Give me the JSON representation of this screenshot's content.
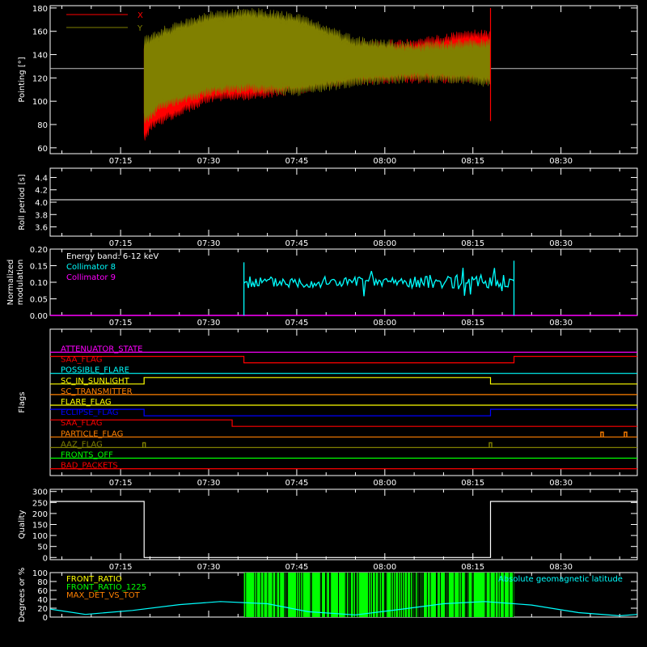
{
  "chart_data": [
    {
      "type": "line",
      "panel": "pointing",
      "ylabel": "Pointing [°]",
      "ylim": [
        55,
        182
      ],
      "yticks": [
        60,
        80,
        100,
        120,
        140,
        160,
        180
      ],
      "xlim": [
        "07:03",
        "08:43"
      ],
      "xticks": [
        "07:15",
        "07:30",
        "07:45",
        "08:00",
        "08:15",
        "08:30"
      ],
      "grid": false,
      "legend_position": "top-left",
      "colors": {
        "X": "#ff0000",
        "Y": "#808000",
        "reference": "#c0c0c0"
      },
      "series": [
        {
          "name": "X",
          "band": {
            "t": [
              "07:19",
              "07:20",
              "07:24",
              "07:30",
              "07:40",
              "07:48",
              "07:55",
              "08:05",
              "08:15",
              "08:18"
            ],
            "max": [
              150,
              138,
              155,
              168,
              165,
              150,
              146,
              148,
              156,
              155
            ],
            "min": [
              67,
              80,
              90,
              104,
              108,
              114,
              119,
              121,
              121,
              120
            ]
          }
        },
        {
          "name": "Y",
          "band": {
            "t": [
              "07:19",
              "07:22",
              "07:30",
              "07:37",
              "07:45",
              "07:50",
              "07:55",
              "08:05",
              "08:15",
              "08:18"
            ],
            "max": [
              150,
              158,
              172,
              175,
              170,
              160,
              150,
              145,
              148,
              148
            ],
            "min": [
              85,
              98,
              110,
              113,
              110,
              114,
              118,
              122,
              120,
              117
            ]
          }
        }
      ],
      "reference_line": 128,
      "spike_time": "08:18",
      "spike_range": [
        83,
        180
      ]
    },
    {
      "type": "line",
      "panel": "roll",
      "ylabel": "Roll period [s]",
      "ylim": [
        3.45,
        4.55
      ],
      "yticks": [
        3.6,
        3.8,
        4.0,
        4.2,
        4.4
      ],
      "xticks": [
        "07:15",
        "07:30",
        "07:45",
        "08:00",
        "08:15",
        "08:30"
      ],
      "series": [
        {
          "t": [
            "07:03",
            "08:43"
          ],
          "values": [
            4.04,
            4.04
          ]
        }
      ]
    },
    {
      "type": "line",
      "panel": "modulation",
      "ylabel": [
        "Normalized",
        "modulation"
      ],
      "ylim": [
        0.0,
        0.2
      ],
      "yticks": [
        0.0,
        0.05,
        0.1,
        0.15,
        0.2
      ],
      "xticks": [
        "07:15",
        "07:30",
        "07:45",
        "08:00",
        "08:15",
        "08:30"
      ],
      "legend_title": "Energy band: 6-12 keV",
      "series": [
        {
          "name": "Collimator 8",
          "color": "#00ffff",
          "active_range": [
            "07:36",
            "08:22"
          ],
          "baseline": 0.1,
          "jitter": 0.018
        },
        {
          "name": "Collimator 9",
          "color": "#ff00ff",
          "values": 0.0
        }
      ]
    },
    {
      "type": "line",
      "panel": "flags",
      "ylabel": "Flags",
      "xticks": [
        "07:15",
        "07:30",
        "07:45",
        "08:00",
        "08:15",
        "08:30"
      ],
      "series": [
        {
          "name": "ATTENUATOR_STATE",
          "color": "#ff00ff",
          "segments": [
            [
              "07:03",
              0
            ],
            [
              "08:43",
              0
            ]
          ]
        },
        {
          "name": "SAA_FLAG",
          "color": "#ff0000",
          "segments": [
            [
              "07:03",
              1
            ],
            [
              "07:36",
              0
            ],
            [
              "08:22",
              1
            ],
            [
              "08:43",
              1
            ]
          ]
        },
        {
          "name": "POSSIBLE_FLARE",
          "color": "#00ffff",
          "segments": [
            [
              "07:03",
              0
            ],
            [
              "08:43",
              0
            ]
          ]
        },
        {
          "name": "SC_IN_SUNLIGHT",
          "color": "#ffff00",
          "segments": [
            [
              "07:03",
              0
            ],
            [
              "07:19",
              1
            ],
            [
              "08:18",
              0
            ],
            [
              "08:43",
              0
            ]
          ]
        },
        {
          "name": "SC_TRANSMITTER",
          "color": "#ff8000",
          "segments": [
            [
              "07:03",
              0
            ],
            [
              "08:43",
              0
            ]
          ]
        },
        {
          "name": "FLARE_FLAG",
          "color": "#ffff00",
          "segments": [
            [
              "07:03",
              0
            ],
            [
              "08:43",
              0
            ]
          ]
        },
        {
          "name": "ECLIPSE_FLAG",
          "color": "#0000ff",
          "segments": [
            [
              "07:03",
              1
            ],
            [
              "07:19",
              0
            ],
            [
              "08:18",
              1
            ],
            [
              "08:43",
              1
            ]
          ]
        },
        {
          "name": "SAA_FLAG",
          "color": "#ff0000",
          "segments": [
            [
              "07:03",
              1
            ],
            [
              "07:34",
              0
            ],
            [
              "08:43",
              0
            ]
          ]
        },
        {
          "name": "PARTICLE_FLAG",
          "color": "#ff8000",
          "segments": [
            [
              "07:03",
              0
            ],
            [
              "08:43",
              0
            ]
          ],
          "spikes": [
            "08:37",
            "08:41"
          ]
        },
        {
          "name": "AAZ_FLAG",
          "color": "#808000",
          "segments": [
            [
              "07:03",
              0
            ],
            [
              "08:43",
              0
            ]
          ],
          "spikes": [
            "07:19",
            "08:18"
          ]
        },
        {
          "name": "FRONTS_OFF",
          "color": "#00ff00",
          "segments": [
            [
              "07:03",
              0
            ],
            [
              "08:43",
              0
            ]
          ]
        },
        {
          "name": "BAD_PACKETS",
          "color": "#ff0000",
          "segments": [
            [
              "07:03",
              0
            ],
            [
              "08:43",
              0
            ]
          ]
        }
      ]
    },
    {
      "type": "line",
      "panel": "quality",
      "ylabel": "Quality",
      "ylim": [
        -10,
        310
      ],
      "yticks": [
        0,
        50,
        100,
        150,
        200,
        250,
        300
      ],
      "xticks": [
        "07:15",
        "07:30",
        "07:45",
        "08:00",
        "08:15",
        "08:30"
      ],
      "series": [
        {
          "t": [
            "07:03",
            "07:19",
            "07:19",
            "08:18",
            "08:18",
            "08:18",
            "08:18",
            "08:43"
          ],
          "values": [
            255,
            255,
            0,
            0,
            60,
            60,
            255,
            255
          ]
        }
      ]
    },
    {
      "type": "line",
      "panel": "ratios",
      "ylabel": "Degrees or %",
      "ylim": [
        0,
        100
      ],
      "yticks": [
        0,
        20,
        40,
        60,
        80,
        100
      ],
      "legend_right": "Absolute geomagnetic latitude",
      "series": [
        {
          "name": "FRONT_RATIO",
          "color": "#ffff00"
        },
        {
          "name": "FRONT_RATIO_1225",
          "color": "#00ff00",
          "active_range": [
            "07:36",
            "08:22"
          ]
        },
        {
          "name": "MAX_DET_VS_TOT",
          "color": "#ff8000"
        },
        {
          "name": "Absolute geomagnetic latitude",
          "color": "#00ffff",
          "t": [
            "07:03",
            "07:09",
            "07:17",
            "07:25",
            "07:32",
            "07:40",
            "07:47",
            "07:55",
            "08:03",
            "08:10",
            "08:17",
            "08:25",
            "08:33",
            "08:40",
            "08:43"
          ],
          "values": [
            18,
            6,
            15,
            28,
            35,
            30,
            12,
            5,
            18,
            30,
            35,
            27,
            10,
            3,
            6
          ]
        }
      ]
    }
  ]
}
